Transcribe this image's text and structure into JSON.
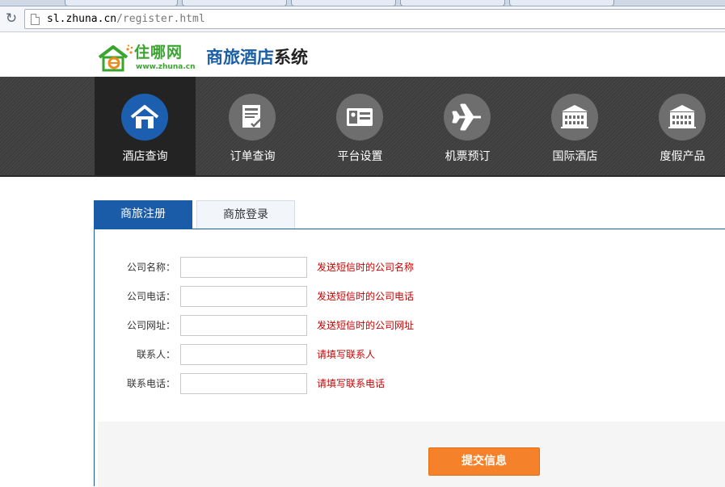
{
  "browser": {
    "url_host": "sl.zhuna.cn",
    "url_path": "/register.html"
  },
  "header": {
    "logo_cn": "住哪网",
    "logo_en": "www.zhuna.cn",
    "system_title_blue": "商旅酒店",
    "system_title_dark": "系统"
  },
  "nav": {
    "items": [
      {
        "label": "酒店查询",
        "icon": "hotel-house-icon",
        "active": true
      },
      {
        "label": "订单查询",
        "icon": "order-document-icon",
        "active": false
      },
      {
        "label": "平台设置",
        "icon": "id-card-icon",
        "active": false
      },
      {
        "label": "机票预订",
        "icon": "airplane-icon",
        "active": false
      },
      {
        "label": "国际酒店",
        "icon": "building-icon",
        "active": false
      },
      {
        "label": "度假产品",
        "icon": "building-icon",
        "active": false
      }
    ]
  },
  "tabs": {
    "register": "商旅注册",
    "login": "商旅登录"
  },
  "form": {
    "fields": [
      {
        "label": "公司名称：",
        "value": "",
        "hint": "发送短信时的公司名称"
      },
      {
        "label": "公司电话：",
        "value": "",
        "hint": "发送短信时的公司电话"
      },
      {
        "label": "公司网址：",
        "value": "",
        "hint": "发送短信时的公司网址"
      },
      {
        "label": "联系人：",
        "value": "",
        "hint": "请填写联系人"
      },
      {
        "label": "联系电话：",
        "value": "",
        "hint": "请填写联系电话"
      }
    ],
    "submit_label": "提交信息"
  },
  "colors": {
    "brand_blue": "#1b5ca8",
    "brand_green": "#3aa52e",
    "hint_red": "#cc0000",
    "submit_orange": "#f5822a"
  }
}
